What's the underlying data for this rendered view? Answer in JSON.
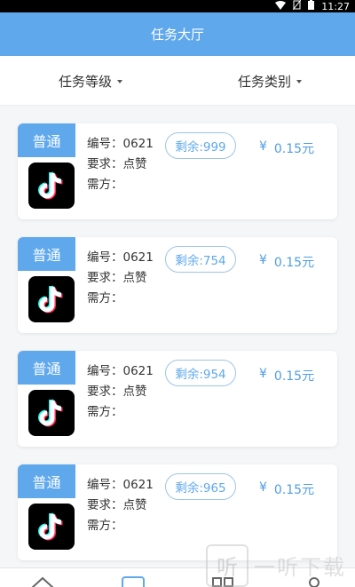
{
  "status_bar": {
    "time": "11:27"
  },
  "header": {
    "title": "任务大厅"
  },
  "filters": {
    "level_label": "任务等级",
    "category_label": "任务类别"
  },
  "tasks": [
    {
      "badge": "普通",
      "id_label": "编号：",
      "id_value": "0621",
      "req_label": "要求：",
      "req_value": "点赞",
      "owner_label": "需方：",
      "owner_value": "",
      "remaining": "剩余:999",
      "price_symbol": "¥",
      "price": "0.15元",
      "icon": "tiktok-icon"
    },
    {
      "badge": "普通",
      "id_label": "编号：",
      "id_value": "0621",
      "req_label": "要求：",
      "req_value": "点赞",
      "owner_label": "需方：",
      "owner_value": "",
      "remaining": "剩余:754",
      "price_symbol": "¥",
      "price": "0.15元",
      "icon": "tiktok-icon"
    },
    {
      "badge": "普通",
      "id_label": "编号：",
      "id_value": "0621",
      "req_label": "要求：",
      "req_value": "点赞",
      "owner_label": "需方：",
      "owner_value": "",
      "remaining": "剩余:954",
      "price_symbol": "¥",
      "price": "0.15元",
      "icon": "tiktok-icon"
    },
    {
      "badge": "普通",
      "id_label": "编号：",
      "id_value": "0621",
      "req_label": "要求：",
      "req_value": "点赞",
      "owner_label": "需方：",
      "owner_value": "",
      "remaining": "剩余:965",
      "price_symbol": "¥",
      "price": "0.15元",
      "icon": "tiktok-icon"
    }
  ],
  "bottom_nav": {
    "items": [
      "home-icon",
      "tasks-icon",
      "apps-icon",
      "profile-icon"
    ]
  },
  "watermark": {
    "logo_char": "听",
    "text": "一听下载"
  },
  "colors": {
    "accent": "#5fa8ec",
    "price": "#4f9de6",
    "background": "#f5f6f8"
  }
}
